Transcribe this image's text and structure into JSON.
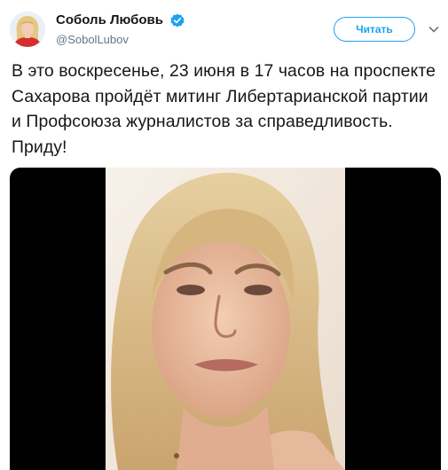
{
  "author": {
    "display_name": "Соболь Любовь",
    "handle": "@SobolLubov",
    "verified_icon": "verified-badge-icon",
    "avatar_icon": "avatar-photo"
  },
  "actions": {
    "follow_label": "Читать",
    "menu_icon": "chevron-down-icon"
  },
  "tweet": {
    "text": "В это воскресенье, 23 июня в 17 часов на проспекте Сахарова пройдёт митинг Либертарианской партии и Профсоюза журналистов за справедливость. Приду!"
  },
  "media": {
    "type": "video",
    "thumbnail": "video-thumbnail-woman-portrait"
  },
  "colors": {
    "accent": "#1da1f2",
    "text": "#14171a",
    "secondary": "#657786",
    "media_background": "#000000"
  }
}
